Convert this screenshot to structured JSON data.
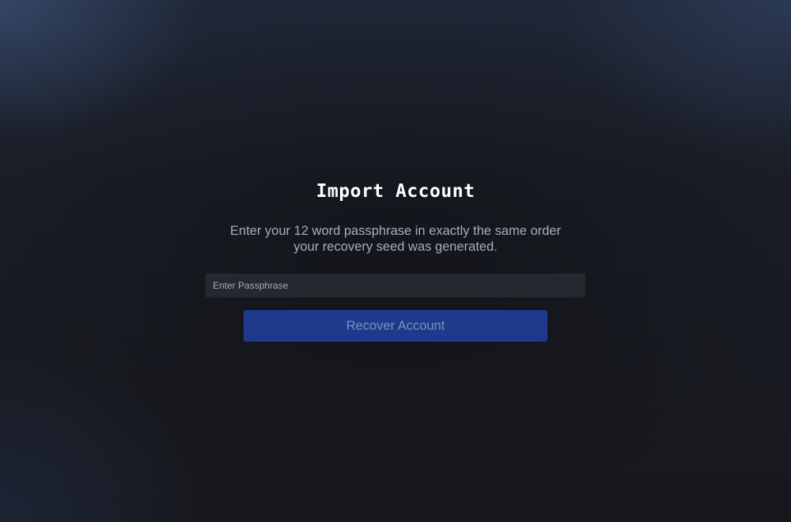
{
  "import_form": {
    "title": "Import Account",
    "description_line1": "Enter your 12 word passphrase in exactly the same order",
    "description_line2": "your recovery seed was generated.",
    "passphrase_input": {
      "placeholder": "Enter Passphrase",
      "value": ""
    },
    "recover_button_label": "Recover Account"
  },
  "colors": {
    "background": "#17181d",
    "title_text": "#ffffff",
    "description_text": "#a7abbf",
    "input_background": "#262830",
    "button_background": "#1e3a8a",
    "button_text": "#7f8fb8"
  }
}
